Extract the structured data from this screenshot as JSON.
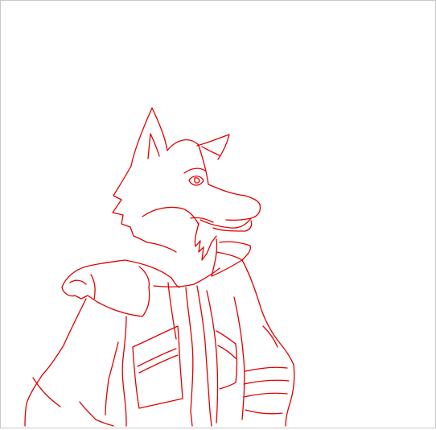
{
  "canvas": {
    "background": "#ffffff",
    "stroke_color": "#e00000",
    "border_color": "#c8c8c8"
  },
  "drawing": {
    "subject": "wolf-character-line-sketch"
  }
}
